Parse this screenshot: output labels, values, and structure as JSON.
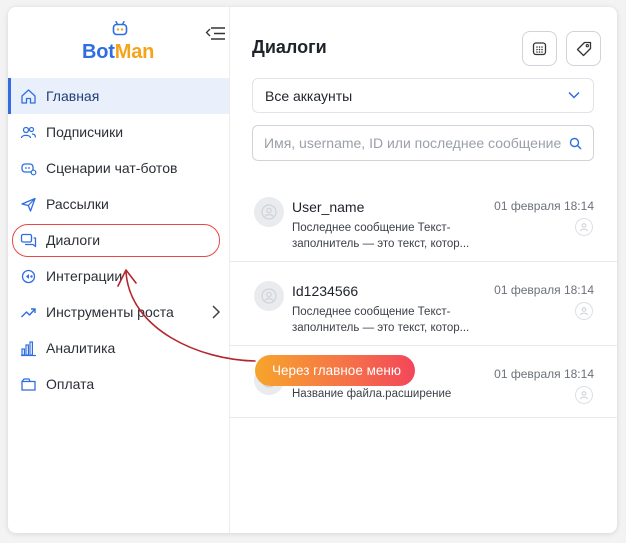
{
  "brand": {
    "name_part1": "Bot",
    "name_part2": "Man",
    "colors": {
      "blue": "#2f6de1",
      "orange": "#f5a31b"
    },
    "icon": "robot-icon"
  },
  "sidebar": {
    "collapse_icon": "menu-collapse-icon",
    "items": [
      {
        "label": "Главная",
        "icon": "home-icon",
        "active": true
      },
      {
        "label": "Подписчики",
        "icon": "users-icon"
      },
      {
        "label": "Сценарии чат-ботов",
        "icon": "chatbot-scenarios-icon"
      },
      {
        "label": "Рассылки",
        "icon": "send-icon"
      },
      {
        "label": "Диалоги",
        "icon": "dialogs-icon",
        "highlighted": true
      },
      {
        "label": "Интеграции",
        "icon": "integrations-icon"
      },
      {
        "label": "Инструменты роста",
        "icon": "growth-icon",
        "has_submenu": true
      },
      {
        "label": "Аналитика",
        "icon": "analytics-icon"
      },
      {
        "label": "Оплата",
        "icon": "payment-icon"
      }
    ]
  },
  "main": {
    "title": "Диалоги",
    "header_buttons": [
      "calendar-icon",
      "tag-icon"
    ],
    "account_select": {
      "value": "Все аккаунты"
    },
    "search": {
      "placeholder": "Имя, username, ID или последнее сообщение"
    },
    "dialogs": [
      {
        "name": "User_name",
        "message": "Последнее сообщение Текст-заполнитель — это текст, котор...",
        "date": "01 февраля 18:14"
      },
      {
        "name": "Id1234566",
        "message": "Последнее сообщение Текст-заполнитель — это текст, котор...",
        "date": "01 февраля 18:14"
      },
      {
        "name": "",
        "message": "Название файла.расширение",
        "date": "01 февраля 18:14"
      }
    ]
  },
  "callout": {
    "text": "Через главное меню",
    "colors": {
      "start": "#f6a52c",
      "end": "#f3465a",
      "arrow": "#b3262c"
    }
  }
}
